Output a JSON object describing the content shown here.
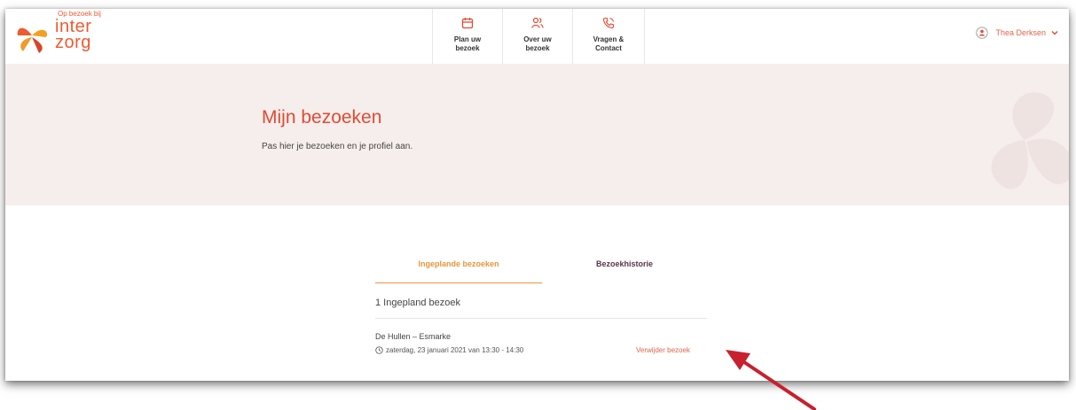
{
  "header": {
    "logo_tagline": "Op bezoek bij",
    "logo_line1": "inter",
    "logo_line2": "zorg",
    "nav": [
      {
        "line1": "Plan uw",
        "line2": "bezoek"
      },
      {
        "line1": "Over uw",
        "line2": "bezoek"
      },
      {
        "line1": "Vragen &",
        "line2": "Contact"
      }
    ],
    "user_name": "Thea Derksen"
  },
  "hero": {
    "title": "Mijn bezoeken",
    "subtitle": "Pas hier je bezoeken en je profiel aan."
  },
  "tabs": {
    "active": "Ingeplande bezoeken",
    "other": "Bezoekhistorie"
  },
  "visits": {
    "count_label": "1 Ingepland bezoek",
    "item": {
      "location": "De Hullen – Esmarke",
      "datetime": "zaterdag, 23 januari 2021  van 13:30 - 14:30",
      "remove_label": "Verwijder bezoek"
    }
  },
  "colors": {
    "accent": "#e24a33",
    "tab_active": "#e8953b",
    "hero_bg": "#f6eeec",
    "annotation_arrow": "#c8202e"
  }
}
